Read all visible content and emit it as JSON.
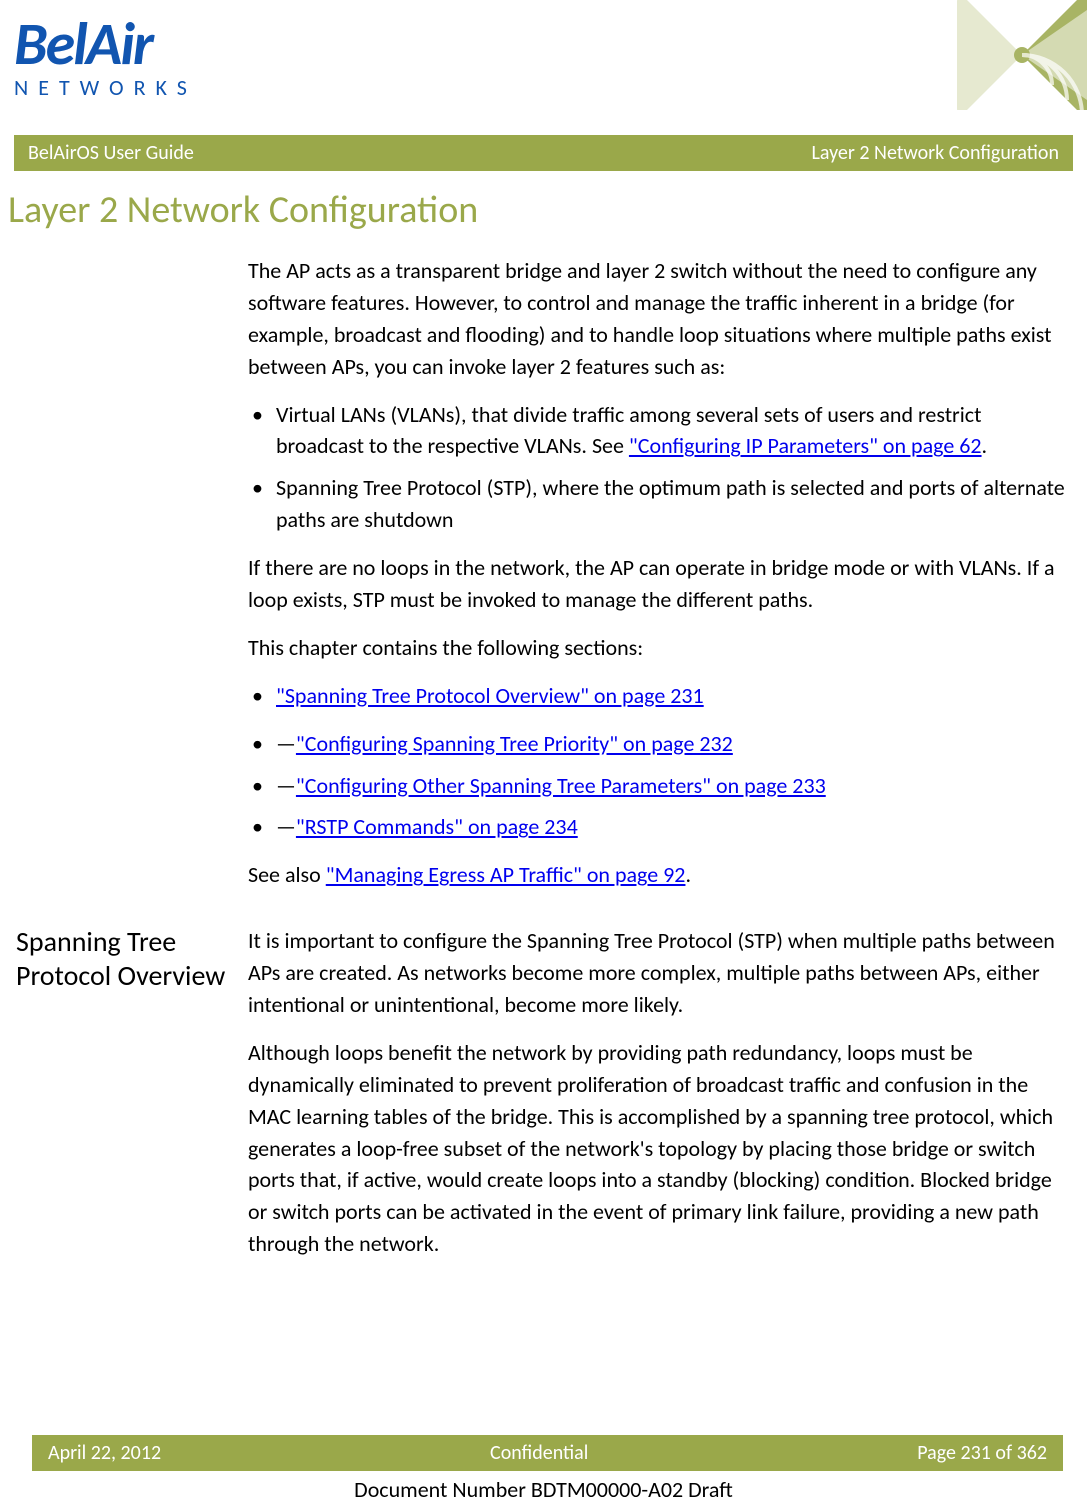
{
  "logo": {
    "top": "BelAir",
    "bottom": "NETWORKS"
  },
  "titleBar": {
    "left": "BelAirOS User Guide",
    "right": "Layer 2 Network Configuration"
  },
  "pageTitle": "Layer 2 Network Configuration",
  "intro": {
    "p1": "The AP acts as a transparent bridge and layer 2 switch without the need to configure any software features. However, to control and manage the traffic inherent in a bridge (for example, broadcast and flooding) and to handle loop situations where multiple paths exist between APs, you can invoke layer 2 features such as:",
    "bullets": {
      "b1_pre": "Virtual LANs (VLANs), that divide traffic among several sets of users and restrict broadcast to the respective VLANs. See ",
      "b1_link": "\"Configuring IP Parameters\" on page 62",
      "b1_post": ".",
      "b2": "Spanning Tree Protocol (STP), where the optimum path is selected and ports of alternate paths are shutdown"
    },
    "p2": "If there are no loops in the network, the AP can operate in bridge mode or with VLANs. If a loop exists, STP must be invoked to manage the different paths.",
    "p3": "This chapter contains the following sections:",
    "toc": {
      "t1": "\"Spanning Tree Protocol Overview\" on page 231",
      "s1": "\"Configuring Spanning Tree Priority\" on page 232",
      "s2": "\"Configuring Other Spanning Tree Parameters\" on page 233",
      "s3": "\"RSTP Commands\" on page 234"
    },
    "seeAlsoPre": "See also ",
    "seeAlsoLink": "\"Managing Egress AP Traffic\" on page 92",
    "seeAlsoPost": "."
  },
  "section2": {
    "heading": "Spanning Tree Protocol Overview",
    "p1": "It is important to configure the Spanning Tree Protocol (STP) when multiple paths between APs are created. As networks become more complex, multiple paths between APs, either intentional or unintentional, become more likely.",
    "p2": "Although loops benefit the network by providing path redundancy, loops must be dynamically eliminated to prevent proliferation of broadcast traffic and confusion in the MAC learning tables of the bridge. This is accomplished by a spanning tree protocol, which generates a loop-free subset of the network's topology by placing those bridge or switch ports that, if active, would create loops into a standby (blocking) condition. Blocked bridge or switch ports can be activated in the event of primary link failure, providing a new path through the network."
  },
  "footer": {
    "left": "April 22, 2012",
    "center": "Confidential",
    "right": "Page 231 of 362"
  },
  "docNumber": "Document Number BDTM00000-A02 Draft"
}
